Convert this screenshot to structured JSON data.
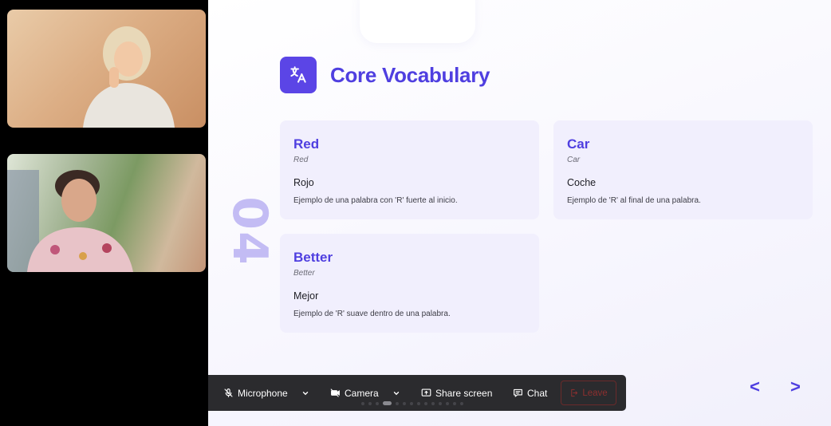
{
  "slide": {
    "title": "Core Vocabulary",
    "number": "04",
    "title_icon": "translate-icon",
    "accent_color": "#4f3fe0",
    "cards": [
      {
        "word": "Red",
        "translation": "Red",
        "spanish": "Rojo",
        "example": "Ejemplo de una palabra con 'R' fuerte al inicio."
      },
      {
        "word": "Car",
        "translation": "Car",
        "spanish": "Coche",
        "example": "Ejemplo de 'R' al final de una palabra."
      },
      {
        "word": "Better",
        "translation": "Better",
        "spanish": "Mejor",
        "example": "Ejemplo de 'R' suave dentro de una palabra."
      }
    ],
    "nav": {
      "prev": "<",
      "next": ">"
    }
  },
  "toolbar": {
    "microphone": "Microphone",
    "camera": "Camera",
    "share_screen": "Share screen",
    "chat": "Chat",
    "leave": "Leave",
    "leave_color": "#8c2f2f"
  },
  "participants": [
    {
      "icon": "participant-video-1"
    },
    {
      "icon": "participant-video-2"
    }
  ]
}
